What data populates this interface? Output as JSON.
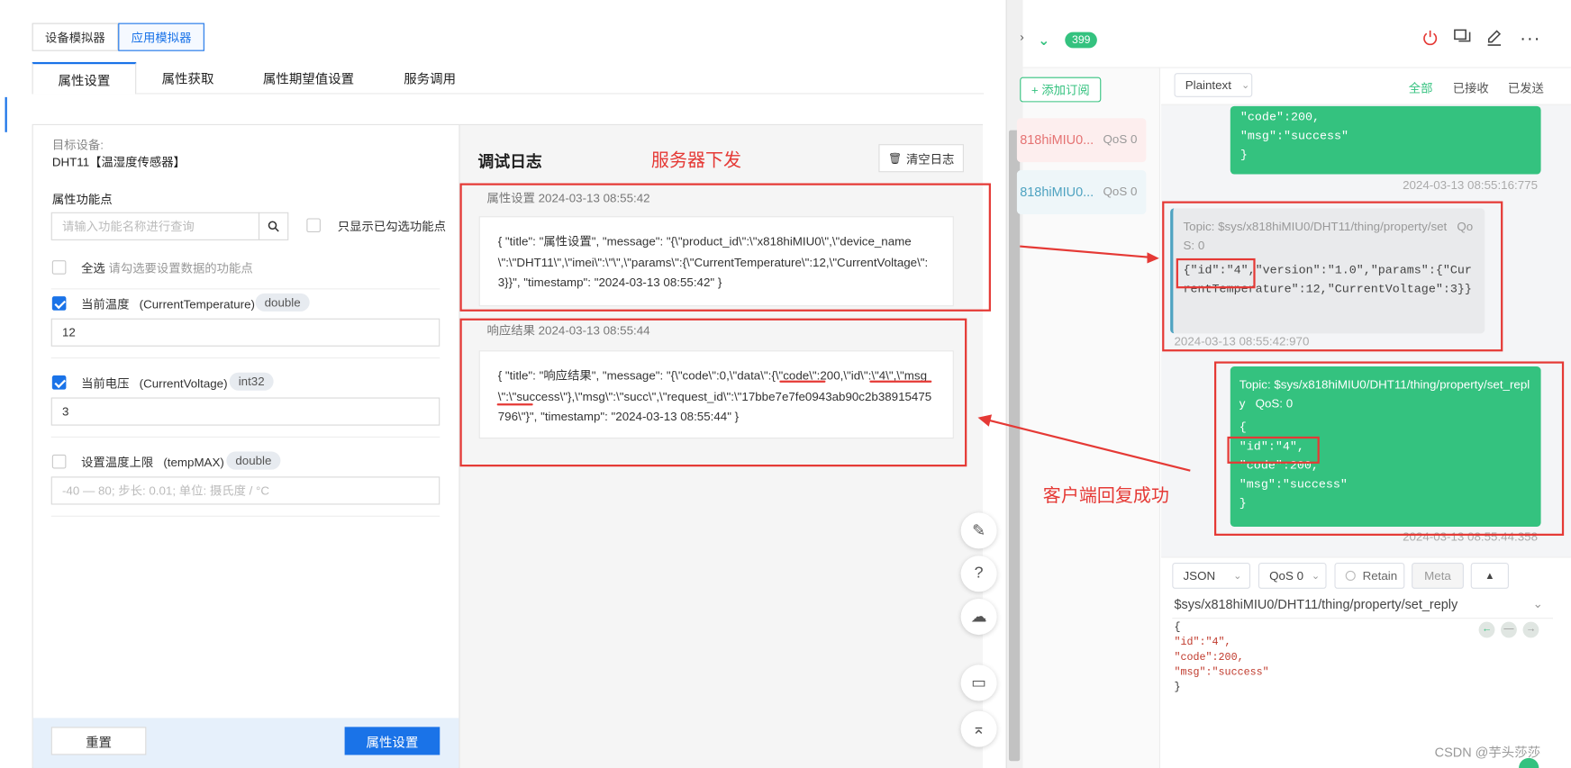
{
  "simulator": {
    "tabs": [
      "设备模拟器",
      "应用模拟器"
    ],
    "subtabs": [
      "属性设置",
      "属性获取",
      "属性期望值设置",
      "服务调用"
    ]
  },
  "device": {
    "label": "目标设备:",
    "name": "DHT11【温湿度传感器】"
  },
  "props": {
    "label": "属性功能点",
    "search_placeholder": "请输入功能名称进行查询",
    "only_checked": "只显示已勾选功能点",
    "select_all": "全选",
    "select_all_hint": "请勾选要设置数据的功能点",
    "items": [
      {
        "name": "当前温度",
        "id": "(CurrentTemperature)",
        "type": "double",
        "value": "12",
        "checked": true
      },
      {
        "name": "当前电压",
        "id": "(CurrentVoltage)",
        "type": "int32",
        "value": "3",
        "checked": true
      },
      {
        "name": "设置温度上限",
        "id": "(tempMAX)",
        "type": "double",
        "value": "",
        "placeholder": "-40 — 80; 步长: 0.01; 单位: 摄氏度 / °C",
        "checked": false
      }
    ]
  },
  "footer": {
    "reset": "重置",
    "submit": "属性设置"
  },
  "log": {
    "title": "调试日志",
    "clear": "清空日志",
    "entries": [
      {
        "header": "属性设置 2024-03-13 08:55:42",
        "body": "{ \"title\": \"属性设置\", \"message\": \"{\\\"product_id\\\":\\\"x818hiMIU0\\\",\\\"device_name\\\":\\\"DHT11\\\",\\\"imei\\\":\\\"\\\",\\\"params\\\":{\\\"CurrentTemperature\\\":12,\\\"CurrentVoltage\\\":3}}\", \"timestamp\": \"2024-03-13 08:55:42\" }"
      },
      {
        "header": "响应结果 2024-03-13 08:55:44",
        "body": "{ \"title\": \"响应结果\", \"message\": \"{\\\"code\\\":0,\\\"data\\\":{\\\"code\\\":200,\\\"id\\\":\\\"4\\\",\\\"msg\\\":\\\"success\\\"},\\\"msg\\\":\\\"succ\\\",\\\"request_id\\\":\\\"17bbe7e7fe0943ab90c2b38915475796\\\"}\", \"timestamp\": \"2024-03-13 08:55:44\" }"
      }
    ]
  },
  "annotations": {
    "server": "服务器下发",
    "client": "客户端回复成功"
  },
  "mqtt": {
    "badge": "399",
    "add_sub": "+ 添加订阅",
    "subs": [
      {
        "name": "818hiMIU0...",
        "qos": "QoS 0"
      },
      {
        "name": "818hiMIU0...",
        "qos": "QoS 0"
      }
    ],
    "format": "Plaintext",
    "filters": [
      "全部",
      "已接收",
      "已发送"
    ],
    "msg1": {
      "lines": [
        "\"code\":200,",
        "\"msg\":\"success\"",
        "}"
      ],
      "time": "2024-03-13 08:55:16:775"
    },
    "msg2": {
      "topic": "Topic: $sys/x818hiMIU0/DHT11/thing/property/set",
      "qos": "QoS: 0",
      "body": "{\"id\":\"4\",\"version\":\"1.0\",\"params\":{\"CurrentTemperature\":12,\"CurrentVoltage\":3}}",
      "time": "2024-03-13 08:55:42:970"
    },
    "msg3": {
      "topic": "Topic: $sys/x818hiMIU0/DHT11/thing/property/set_reply",
      "qos": "QoS: 0",
      "lines": [
        "{",
        "\"id\":\"4\",",
        "\"code\":200,",
        "\"msg\":\"success\"",
        "}"
      ],
      "time": "2024-03-13 08:55:44:358"
    },
    "publish": {
      "format": "JSON",
      "qos": "QoS 0",
      "retain": "Retain",
      "meta": "Meta",
      "topic": "$sys/x818hiMIU0/DHT11/thing/property/set_reply",
      "payload": [
        "{",
        "\"id\":\"4\",",
        "\"code\":200,",
        "\"msg\":\"success\"",
        "}"
      ]
    }
  },
  "watermark": "CSDN @芋头莎莎",
  "colors": {
    "primary": "#1a73e8",
    "green": "#34c27f",
    "red": "#e53935"
  }
}
